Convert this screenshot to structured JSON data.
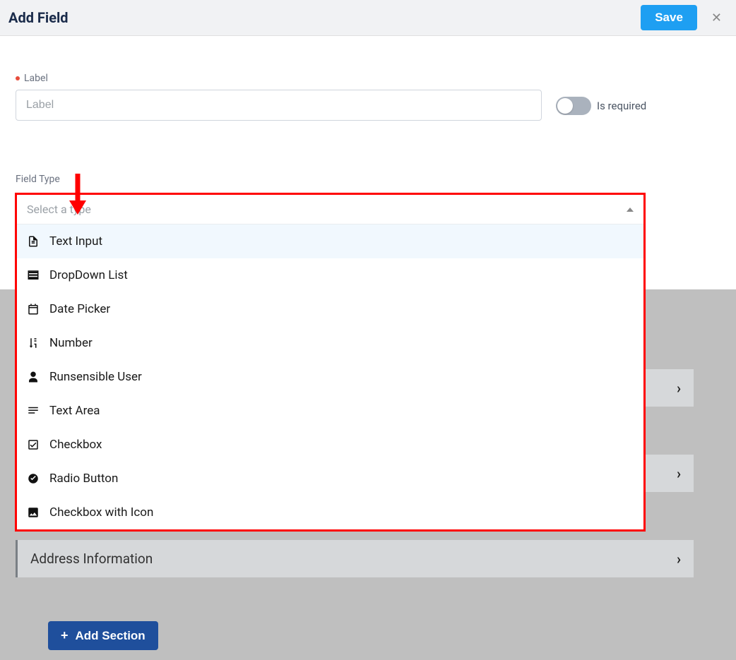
{
  "header": {
    "title": "Add Field",
    "save_label": "Save"
  },
  "label_field": {
    "label": "Label",
    "placeholder": "Label",
    "value": ""
  },
  "required_toggle": {
    "label": "Is required",
    "on": false
  },
  "field_type": {
    "label": "Field Type",
    "placeholder": "Select a type",
    "options": [
      {
        "icon": "file-text",
        "label": "Text Input",
        "hovered": true
      },
      {
        "icon": "list",
        "label": "DropDown List",
        "hovered": false
      },
      {
        "icon": "calendar",
        "label": "Date Picker",
        "hovered": false
      },
      {
        "icon": "sort-numeric",
        "label": "Number",
        "hovered": false
      },
      {
        "icon": "user",
        "label": "Runsensible User",
        "hovered": false
      },
      {
        "icon": "lines",
        "label": "Text Area",
        "hovered": false
      },
      {
        "icon": "check-square",
        "label": "Checkbox",
        "hovered": false
      },
      {
        "icon": "radio-dot",
        "label": "Radio Button",
        "hovered": false
      },
      {
        "icon": "image",
        "label": "Checkbox with Icon",
        "hovered": false
      }
    ]
  },
  "background_sections": [
    {
      "label": ""
    },
    {
      "label": ""
    },
    {
      "label": "Address Information"
    }
  ],
  "add_section_label": "Add Section",
  "annotation": {
    "arrow_color": "#ff0000",
    "highlight_color": "#ff0000"
  }
}
